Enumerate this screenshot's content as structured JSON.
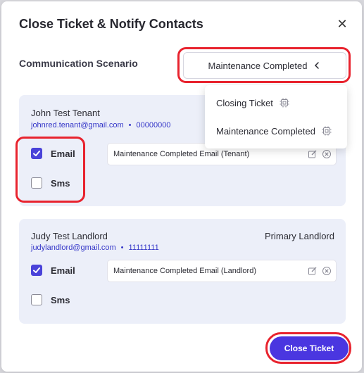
{
  "modal": {
    "title": "Close Ticket & Notify Contacts",
    "close_icon": "close-icon"
  },
  "scenario": {
    "label": "Communication Scenario",
    "selected": "Maintenance Completed",
    "options": [
      {
        "label": "Closing Ticket",
        "icon": "chip-icon"
      },
      {
        "label": "Maintenance Completed",
        "icon": "chip-icon"
      }
    ]
  },
  "contacts": [
    {
      "name": "John Test Tenant",
      "email": "johnred.tenant@gmail.com",
      "separator": "•",
      "phone": "00000000",
      "role": "",
      "email_checkbox_label": "Email",
      "email_checked": true,
      "sms_checkbox_label": "Sms",
      "sms_checked": false,
      "email_template": "Maintenance Completed Email (Tenant)"
    },
    {
      "name": "Judy Test Landlord",
      "email": "judylandlord@gmail.com",
      "separator": "•",
      "phone": "11111111",
      "role": "Primary Landlord",
      "email_checkbox_label": "Email",
      "email_checked": true,
      "sms_checkbox_label": "Sms",
      "sms_checked": false,
      "email_template": "Maintenance Completed Email (Landlord)"
    }
  ],
  "footer": {
    "primary_button": "Close Ticket"
  },
  "colors": {
    "accent": "#4a36e0",
    "card_bg": "#eceff9",
    "link": "#3436c8",
    "highlight": "#e8232e"
  }
}
